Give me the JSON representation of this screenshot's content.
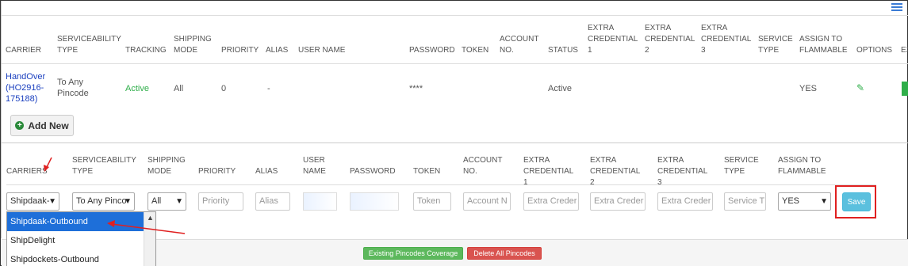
{
  "top_table": {
    "headers": [
      "CARRIER",
      "SERVICEABILITY TYPE",
      "TRACKING",
      "SHIPPING MODE",
      "PRIORITY",
      "ALIAS",
      "USER NAME",
      "PASSWORD",
      "TOKEN",
      "ACCOUNT NO.",
      "STATUS",
      "EXTRA CREDENTIAL 1",
      "EXTRA CREDENTIAL 2",
      "EXTRA CREDENTIAL 3",
      "SERVICE TYPE",
      "ASSIGN TO FLAMMABLE",
      "OPTIONS",
      "EX"
    ],
    "row": {
      "carrier": "HandOver (HO2916-175188)",
      "serviceability": "To Any Pincode",
      "tracking": "Active",
      "shipping_mode": "All",
      "priority": "0",
      "alias": "-",
      "password": "****",
      "status": "Active",
      "flammable": "YES"
    }
  },
  "add_new_label": "Add New",
  "form": {
    "headers": [
      "CARRIERS",
      "SERVICEABILITY TYPE",
      "SHIPPING MODE",
      "PRIORITY",
      "ALIAS",
      "USER NAME",
      "PASSWORD",
      "TOKEN",
      "ACCOUNT NO.",
      "EXTRA CREDENTIAL 1",
      "EXTRA CREDENTIAL 2",
      "EXTRA CREDENTIAL 3",
      "SERVICE TYPE",
      "ASSIGN TO FLAMMABLE"
    ],
    "carrier_value": "Shipdaak-",
    "serviceability_value": "To Any Pinco",
    "shipping_mode_value": "All",
    "placeholders": {
      "priority": "Priority",
      "alias": "Alias",
      "token": "Token",
      "account": "Account N",
      "extra1": "Extra Creder",
      "extra2": "Extra Creder",
      "extra3": "Extra Creder",
      "service": "Service T"
    },
    "flammable_value": "YES",
    "save_label": "Save"
  },
  "dropdown_options": [
    "Shipdaak-Outbound",
    "ShipDelight",
    "Shipdockets-Outbound"
  ],
  "footer": {
    "coverage_label": "Existing Pincodes Coverage",
    "delete_label": "Delete All Pincodes"
  },
  "colors": {
    "accent_blue": "#1e6fd9",
    "save_blue": "#5bc0de",
    "green": "#5cb85c",
    "red": "#d9534f",
    "highlight_red": "#e02020"
  }
}
